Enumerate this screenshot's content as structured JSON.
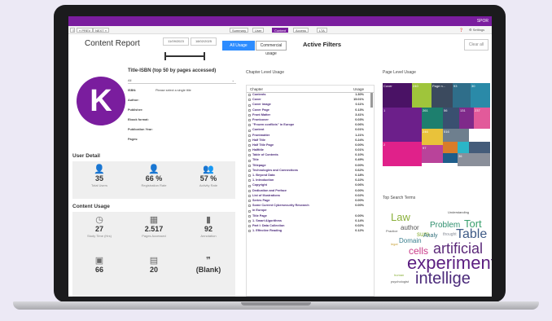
{
  "topbar": {
    "user": "SPOR"
  },
  "toolbar": {
    "prev": "« PREV",
    "next": "NEXT »",
    "tabs": [
      "Summary",
      "User",
      "Content",
      "Access",
      "LTA"
    ],
    "active_tab": 2,
    "settings": "⚙ Settings"
  },
  "header": {
    "title": "Content Report",
    "date_from": "11/09/2023",
    "date_to": "18/02/2025",
    "all_usage": "All Usage",
    "commercial_usage": "Commercial usage",
    "active_filters": "Active Filters",
    "clear_all": "Clear all"
  },
  "profile": {
    "avatar_letter": "K",
    "isbn_title": "Title-ISBN (top 50 by pages accessed)",
    "select_value": "All",
    "fields": [
      {
        "label": "ISBN:",
        "value": "Please select a single title"
      },
      {
        "label": "Author:",
        "value": ""
      },
      {
        "label": "Publisher:",
        "value": ""
      },
      {
        "label": "Ebook format:",
        "value": ""
      },
      {
        "label": "Publication Year:",
        "value": ""
      },
      {
        "label": "Pages:",
        "value": ""
      }
    ]
  },
  "user_detail": {
    "title": "User Detail",
    "stats": [
      {
        "icon": "user-icon",
        "glyph": "👤",
        "value": "35",
        "label": "Total Users"
      },
      {
        "icon": "user-check-icon",
        "glyph": "👤",
        "value": "66 %",
        "label": "Registration Rate"
      },
      {
        "icon": "user-activity-icon",
        "glyph": "👥",
        "value": "57 %",
        "label": "Activity Rate"
      }
    ]
  },
  "content_usage": {
    "title": "Content Usage",
    "stats": [
      {
        "icon": "clock-icon",
        "glyph": "◷",
        "value": "27",
        "label": "Study Time (Hrs)"
      },
      {
        "icon": "book-icon",
        "glyph": "▦",
        "value": "2.517",
        "label": "Pages Accessed"
      },
      {
        "icon": "note-icon",
        "glyph": "▮",
        "value": "92",
        "label": "Annotation"
      },
      {
        "icon": "search-doc-icon",
        "glyph": "▣",
        "value": "66",
        "label": ""
      },
      {
        "icon": "print-icon",
        "glyph": "▤",
        "value": "20",
        "label": ""
      },
      {
        "icon": "quote-icon",
        "glyph": "❞",
        "value": "(Blank)",
        "label": ""
      }
    ]
  },
  "chapter": {
    "title": "Chapter Level Usage",
    "col_chapter": "Chapter",
    "col_usage": "Usage",
    "rows": [
      [
        "Contents",
        "1.30%"
      ],
      [
        "Cover",
        "15.01%"
      ],
      [
        "Cover image",
        "0.11%"
      ],
      [
        "Cover Page",
        "0.13%"
      ],
      [
        "Front Matter",
        "3.41%"
      ],
      [
        "Frontcover",
        "0.03%"
      ],
      [
        "\"Frozen conflicts\" in Europe",
        "0.06%"
      ],
      [
        "Content",
        "0.01%"
      ],
      [
        "Frontmatter",
        "1.21%"
      ],
      [
        "Half Title",
        "0.24%"
      ],
      [
        "Half Title Page",
        "0.00%"
      ],
      [
        "Halftitle",
        "0.01%"
      ],
      [
        "Table of Contents",
        "0.10%"
      ],
      [
        "Title",
        "0.49%"
      ],
      [
        "Titlepage",
        "0.00%"
      ],
      [
        "Technologies and Connections",
        "0.62%"
      ],
      [
        "1. Beyond Data",
        "0.18%"
      ],
      [
        "1. Introduction",
        "0.22%"
      ],
      [
        "Copyright",
        "0.06%"
      ],
      [
        "Dedication and Preface",
        "0.00%"
      ],
      [
        "List of Illustrations",
        "0.02%"
      ],
      [
        "Series Page",
        "0.00%"
      ],
      [
        "Some Current Cybersecurity Research",
        "0.00%"
      ],
      [
        "in Europe",
        ""
      ],
      [
        "Title Page",
        "0.00%"
      ],
      [
        "1. Smart Algorithms",
        "0.14%"
      ],
      [
        "Part I: Data Collection",
        "0.02%"
      ],
      [
        "1. Effective Reading",
        "0.12%"
      ]
    ]
  },
  "page_level": {
    "title": "Page Level Usage",
    "cells": [
      {
        "label": "Cover",
        "color": "#4a1265"
      },
      {
        "label": "240",
        "color": "#9fc53b"
      },
      {
        "label": "Page n...",
        "color": "#3b4a5e"
      },
      {
        "label": "93",
        "color": "#2f6e8a"
      },
      {
        "label": "30",
        "color": "#2a8aa8"
      },
      {
        "label": "1",
        "color": "#6c1f8a"
      },
      {
        "label": "261",
        "color": "#1d7f6e"
      },
      {
        "label": "56",
        "color": "#3a5070"
      },
      {
        "label": "131",
        "color": "#7f2a8a"
      },
      {
        "label": "237",
        "color": "#e25a9a"
      },
      {
        "label": "516",
        "color": "#6e7f8e"
      },
      {
        "label": "246",
        "color": "#e9c23a"
      },
      {
        "label": "2",
        "color": "#e0218a"
      },
      {
        "label": "97",
        "color": "#b9439a"
      },
      {
        "label": "",
        "color": "#d97c2a"
      },
      {
        "label": "",
        "color": "#2bb5c7"
      },
      {
        "label": "",
        "color": "#445c7a"
      },
      {
        "label": "36",
        "color": "#8a8f9a"
      },
      {
        "label": "",
        "color": "#1e5d8a"
      }
    ]
  },
  "search_terms": {
    "title": "Top Search Terms",
    "words": [
      {
        "t": "Law",
        "c": "#8ab03a"
      },
      {
        "t": "Understanding",
        "c": "#444"
      },
      {
        "t": "Problem",
        "c": "#2e8f6e"
      },
      {
        "t": "Tort",
        "c": "#3aa06e"
      },
      {
        "t": "author",
        "c": "#555"
      },
      {
        "t": "Table",
        "c": "#3e5a86"
      },
      {
        "t": "artificial",
        "c": "#5c2a7a"
      },
      {
        "t": "cells",
        "c": "#c93c8a"
      },
      {
        "t": "experiment",
        "c": "#5b1e80"
      },
      {
        "t": "intellige",
        "c": "#4b2a7a"
      },
      {
        "t": "Domain",
        "c": "#3a7f8f"
      },
      {
        "t": "sum",
        "c": "#8ab03a"
      },
      {
        "t": "Analy",
        "c": "#2e6e7a"
      },
      {
        "t": "thought",
        "c": "#8a8f9a"
      },
      {
        "t": "Practice",
        "c": "#555"
      },
      {
        "t": "legal",
        "c": "#c9a23a"
      },
      {
        "t": "psychologist",
        "c": "#555"
      },
      {
        "t": "human",
        "c": "#8ab03a"
      }
    ]
  }
}
